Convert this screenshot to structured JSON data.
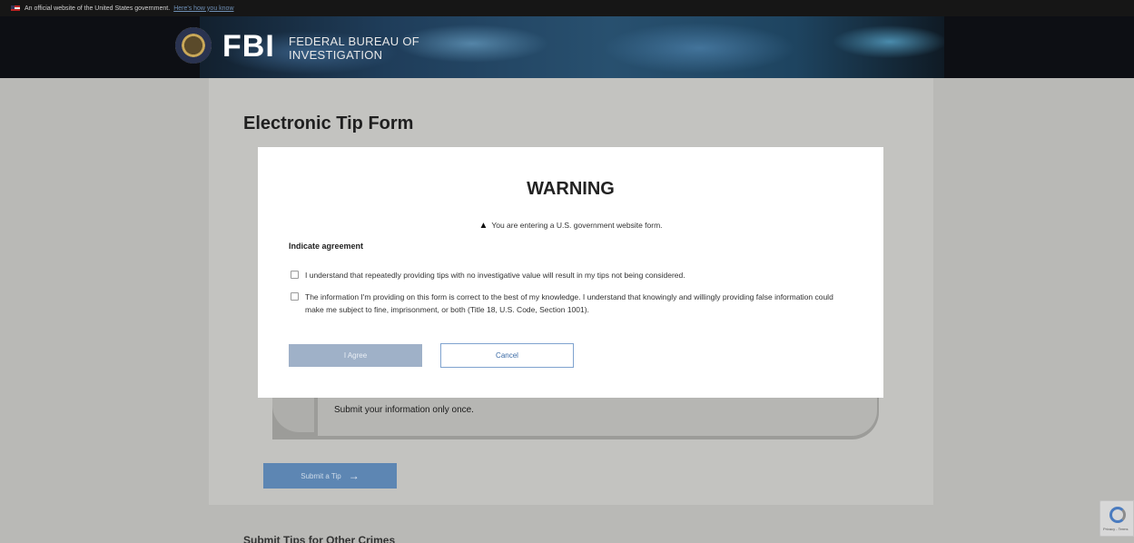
{
  "gov_banner": {
    "text": "An official website of the United States government.",
    "link": "Here's how you know"
  },
  "header": {
    "logo": "FBI",
    "bureau_line_1": "FEDERAL BUREAU OF",
    "bureau_line_2": "INVESTIGATION"
  },
  "page": {
    "title": "Electronic Tip Form",
    "info_text": "Submit your information only once.",
    "submit_label": "Submit a Tip",
    "next_section": "Submit Tips for Other Crimes"
  },
  "modal": {
    "title": "WARNING",
    "warning_text": "You are entering a U.S. government website form.",
    "agreement_heading": "Indicate agreement",
    "checkbox_1": "I understand that repeatedly providing tips with no investigative value will result in my tips not being considered.",
    "checkbox_2": "The information I'm providing on this form is correct to the best of my knowledge. I understand that knowingly and willingly providing false information could make me subject to fine, imprisonment, or both (Title 18, U.S. Code, Section 1001).",
    "agree_label": "I Agree",
    "cancel_label": "Cancel"
  },
  "recaptcha": {
    "caption": "Privacy - Terms"
  },
  "icons": {
    "warning": "warning-triangle-icon",
    "arrow": "arrow-right-icon",
    "seal": "fbi-seal-icon",
    "flag": "us-flag-icon"
  },
  "colors": {
    "header_bg": "#0d0f14",
    "submit_button": "#5d86b3",
    "agree_button": "#9fb1c8",
    "cancel_border": "#7fa3cf"
  }
}
